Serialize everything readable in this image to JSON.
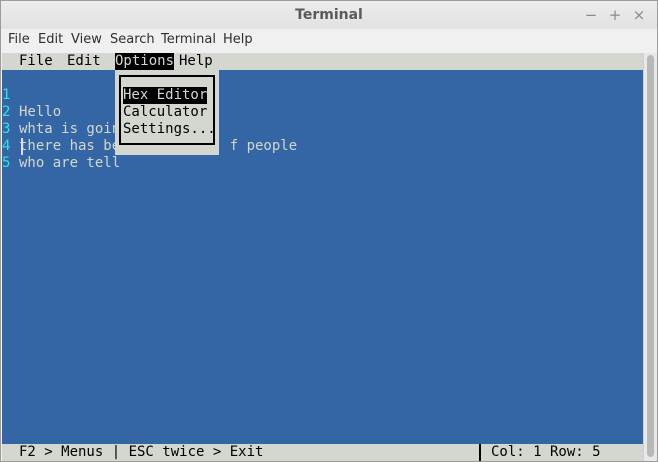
{
  "window": {
    "title": "Terminal",
    "controls": {
      "minimize": "−",
      "maximize": "+",
      "close": "×"
    }
  },
  "app_menu": [
    "File",
    "Edit",
    "View",
    "Search",
    "Terminal",
    "Help"
  ],
  "editor": {
    "menubar": [
      "File",
      "Edit",
      "Options",
      "Help"
    ],
    "active_menu": "Options",
    "lines": [
      {
        "num": "1",
        "text": "Hello"
      },
      {
        "num": "2",
        "text": "whta is goin"
      },
      {
        "num": "3",
        "text": "there has be             f people"
      },
      {
        "num": "4",
        "text": "who are tell"
      },
      {
        "num": "5",
        "text": ""
      }
    ],
    "dropdown": {
      "items": [
        "Hex Editor",
        "Calculator",
        "Settings..."
      ],
      "selected": "Hex Editor"
    },
    "status": {
      "left": "F2 > Menus | ESC twice > Exit",
      "right": "Col: 1 Row: 5"
    }
  },
  "colors": {
    "terminal_bg": "#3465a4",
    "terminal_fg": "#d3d7cf",
    "line_number": "#34e2e2"
  }
}
